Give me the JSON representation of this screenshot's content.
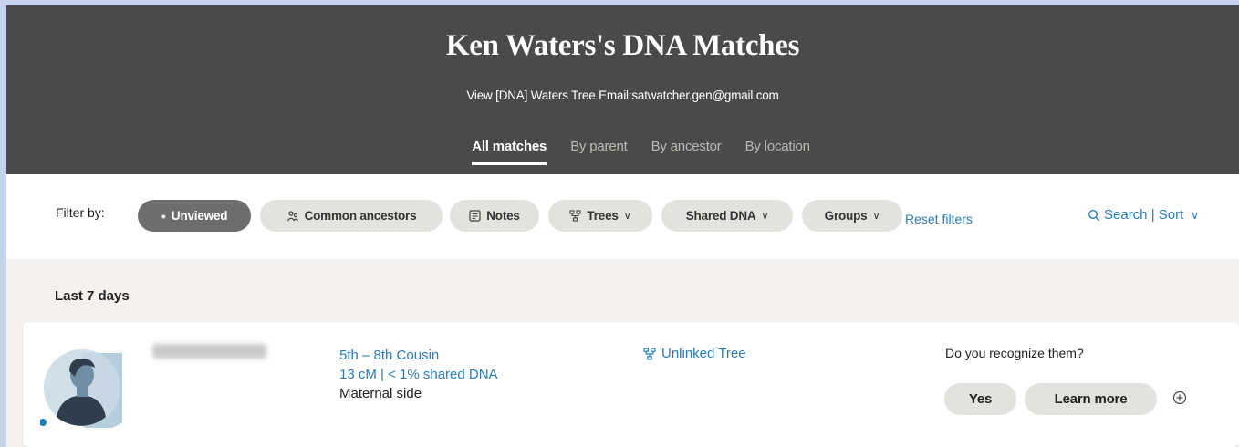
{
  "header": {
    "title": "Ken Waters's DNA Matches",
    "subline": "View [DNA] Waters Tree Email:satwatcher.gen@gmail.com",
    "tabs": [
      {
        "label": "All matches",
        "active": true
      },
      {
        "label": "By parent",
        "active": false
      },
      {
        "label": "By ancestor",
        "active": false
      },
      {
        "label": "By location",
        "active": false
      }
    ]
  },
  "filters": {
    "label": "Filter by:",
    "unviewed": "Unviewed",
    "common_ancestors": "Common ancestors",
    "notes": "Notes",
    "trees": "Trees",
    "shared_dna": "Shared DNA",
    "groups": "Groups",
    "reset": "Reset filters",
    "search_sort": "Search | Sort"
  },
  "section": {
    "heading": "Last 7 days"
  },
  "match": {
    "relationship": "5th – 8th Cousin",
    "shared": "13 cM | < 1% shared DNA",
    "side": "Maternal side",
    "tree": "Unlinked Tree",
    "question": "Do you recognize them?",
    "yes": "Yes",
    "learn_more": "Learn more"
  },
  "colors": {
    "header_bg": "#4a4a48",
    "link_blue": "#2a7bb8",
    "pill_bg": "#e4e2df",
    "page_bg": "#f4f1ee",
    "new_dot": "#1b7fbd"
  },
  "icons": {
    "common_ancestors": "people-icon",
    "notes": "note-icon",
    "trees": "tree-icon",
    "search": "search-icon",
    "chevron": "chevron-down-icon",
    "expand": "plus-circle-icon",
    "avatar": "person-avatar-icon"
  }
}
